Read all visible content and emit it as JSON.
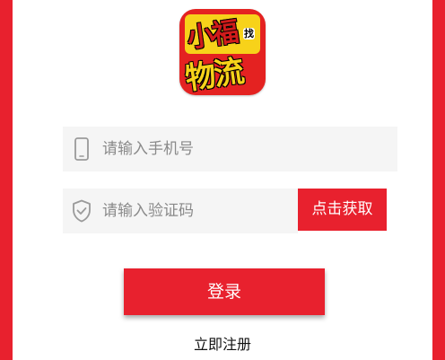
{
  "logo": {
    "line1": "小福",
    "line2": "物流",
    "badge": "找",
    "icon": "app-logo",
    "colors": {
      "red": "#e42221",
      "yellow": "#f7d21a"
    }
  },
  "phone_field": {
    "placeholder": "请输入手机号",
    "value": "",
    "icon": "phone-icon"
  },
  "code_field": {
    "placeholder": "请输入验证码",
    "value": "",
    "icon": "shield-check-icon"
  },
  "get_code_button": {
    "label": "点击获取"
  },
  "login_button": {
    "label": "登录"
  },
  "register_link": {
    "label": "立即注册"
  },
  "theme": {
    "accent": "#e8212e",
    "field_bg": "#f5f5f5",
    "background": "#ffffff"
  }
}
